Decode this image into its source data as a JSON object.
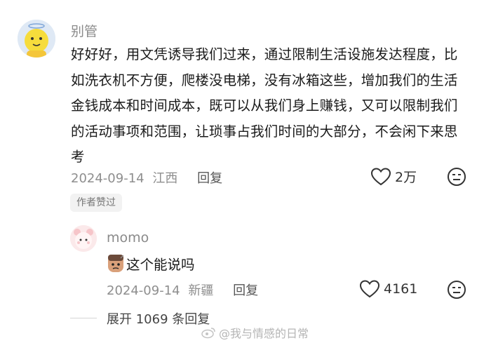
{
  "comment": {
    "username": "别管",
    "text": "好好好，用文凭诱导我们过来，通过限制生活设施发达程度，比如洗衣机不方便，爬楼没电梯，没有冰箱这些，增加我们的生活金钱成本和时间成本，既可以从我们身上赚钱，又可以限制我们的活动事项和范围，让琐事占我们时间的大部分，不会闲下来思考",
    "date": "2024-09-14",
    "location": "江西",
    "reply_label": "回复",
    "likes": "2万",
    "badge": "作者赞过"
  },
  "reply": {
    "username": "momo",
    "text": "这个能说吗",
    "date": "2024-09-14",
    "location": "新疆",
    "reply_label": "回复",
    "likes": "4161"
  },
  "expand_label": "展开 1069 条回复",
  "watermark": "@我与情感的日常",
  "colors": {
    "meta": "#8e8e8e",
    "username": "#8a8a8a",
    "badge_bg": "#f2f2f2"
  }
}
